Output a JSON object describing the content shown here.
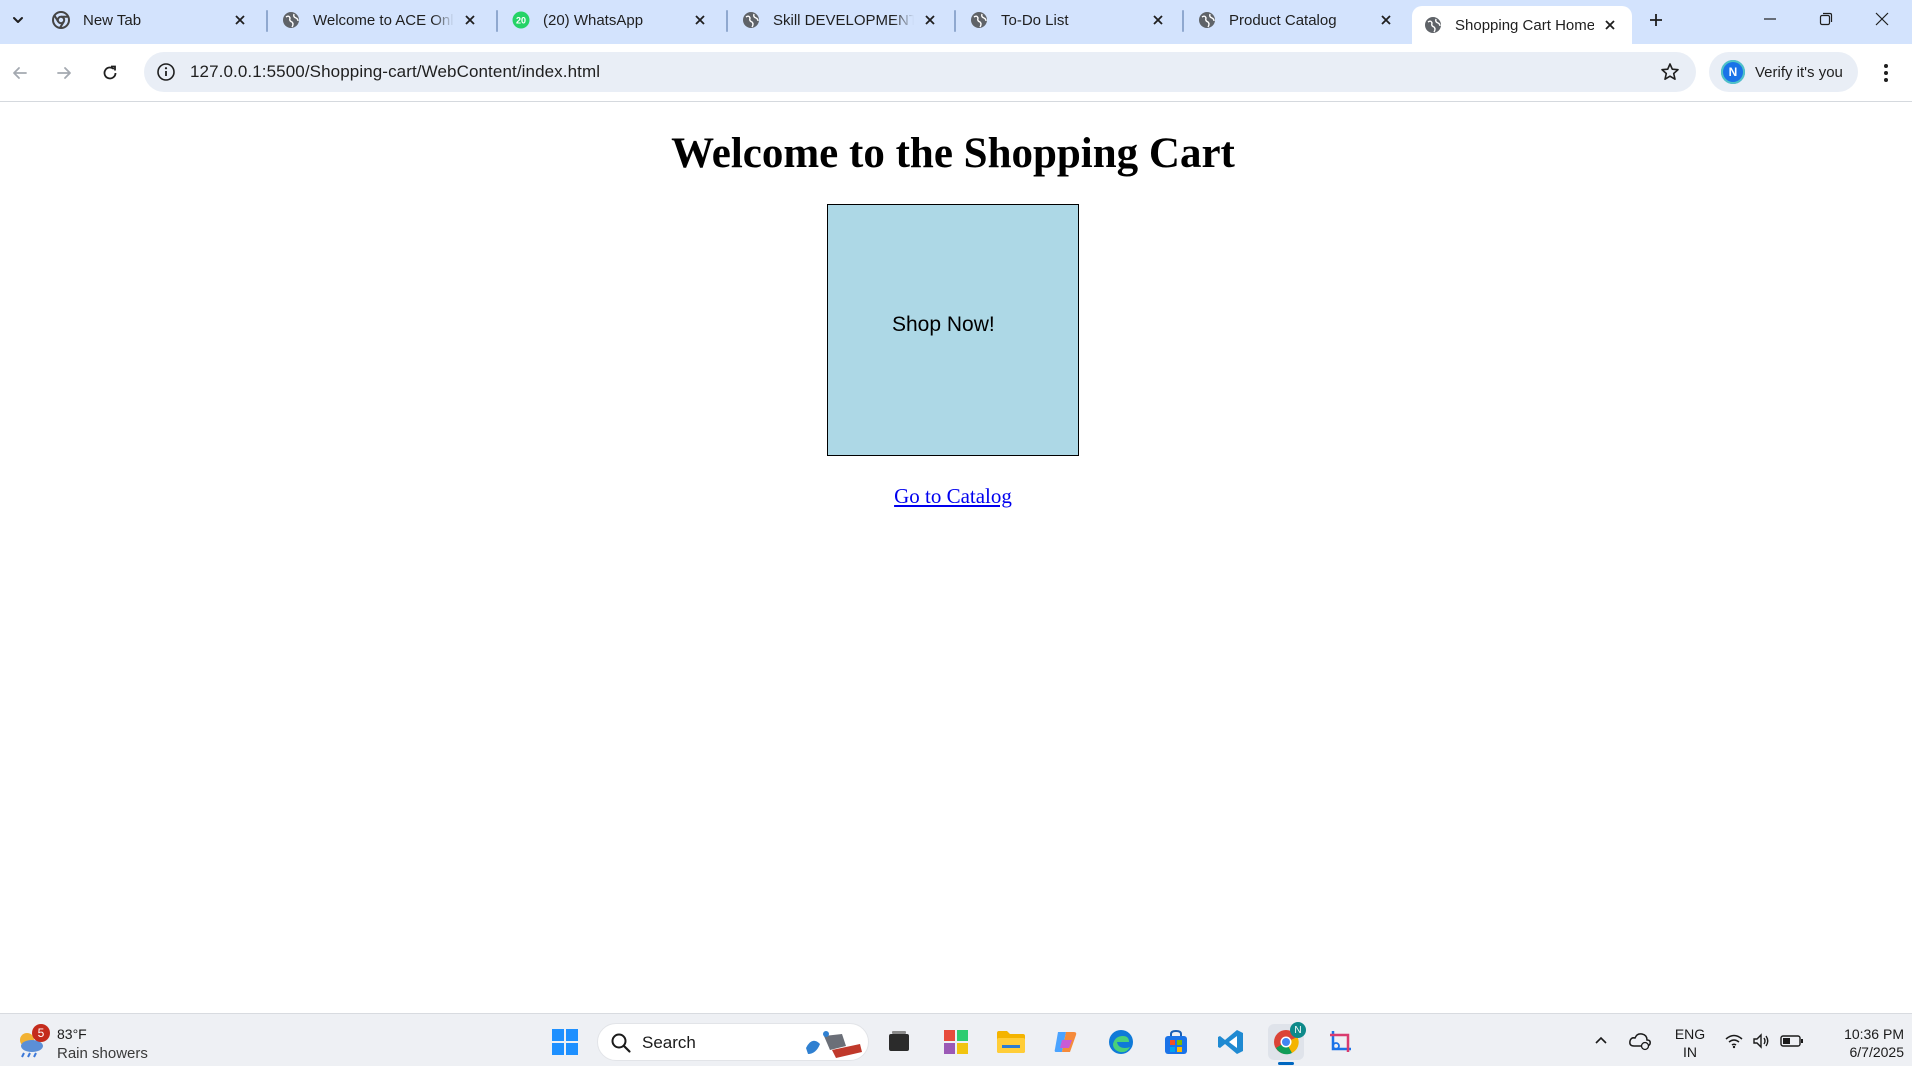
{
  "browser": {
    "tabs": [
      {
        "title": "New Tab",
        "icon": "chrome-icon",
        "active": false
      },
      {
        "title": "Welcome to ACE Online",
        "icon": "globe-icon",
        "active": false
      },
      {
        "title": "(20) WhatsApp",
        "icon": "whatsapp-icon",
        "badge": "20",
        "active": false
      },
      {
        "title": "Skill DEVELOPMENT",
        "icon": "globe-icon",
        "active": false
      },
      {
        "title": "To-Do List",
        "icon": "globe-icon",
        "active": false
      },
      {
        "title": "Product Catalog",
        "icon": "globe-icon",
        "active": false
      },
      {
        "title": "Shopping Cart Home",
        "icon": "globe-icon",
        "active": true
      }
    ],
    "url": "127.0.0.1:5500/Shopping-cart/WebContent/index.html",
    "profile": {
      "initial": "N",
      "label": "Verify it's you"
    }
  },
  "page": {
    "heading": "Welcome to the Shopping Cart",
    "shop_button_label": "Shop Now!",
    "catalog_link": "Go to Catalog",
    "shop_button_color": "#add8e6",
    "link_color": "#0000ee"
  },
  "taskbar": {
    "weather": {
      "badge": "5",
      "temperature": "83°F",
      "condition": "Rain showers"
    },
    "search_placeholder": "Search",
    "language": {
      "line1": "ENG",
      "line2": "IN"
    },
    "clock": {
      "time": "10:36 PM",
      "date": "6/7/2025"
    },
    "chrome_badge": "N",
    "accent_color": "#0067c0"
  }
}
